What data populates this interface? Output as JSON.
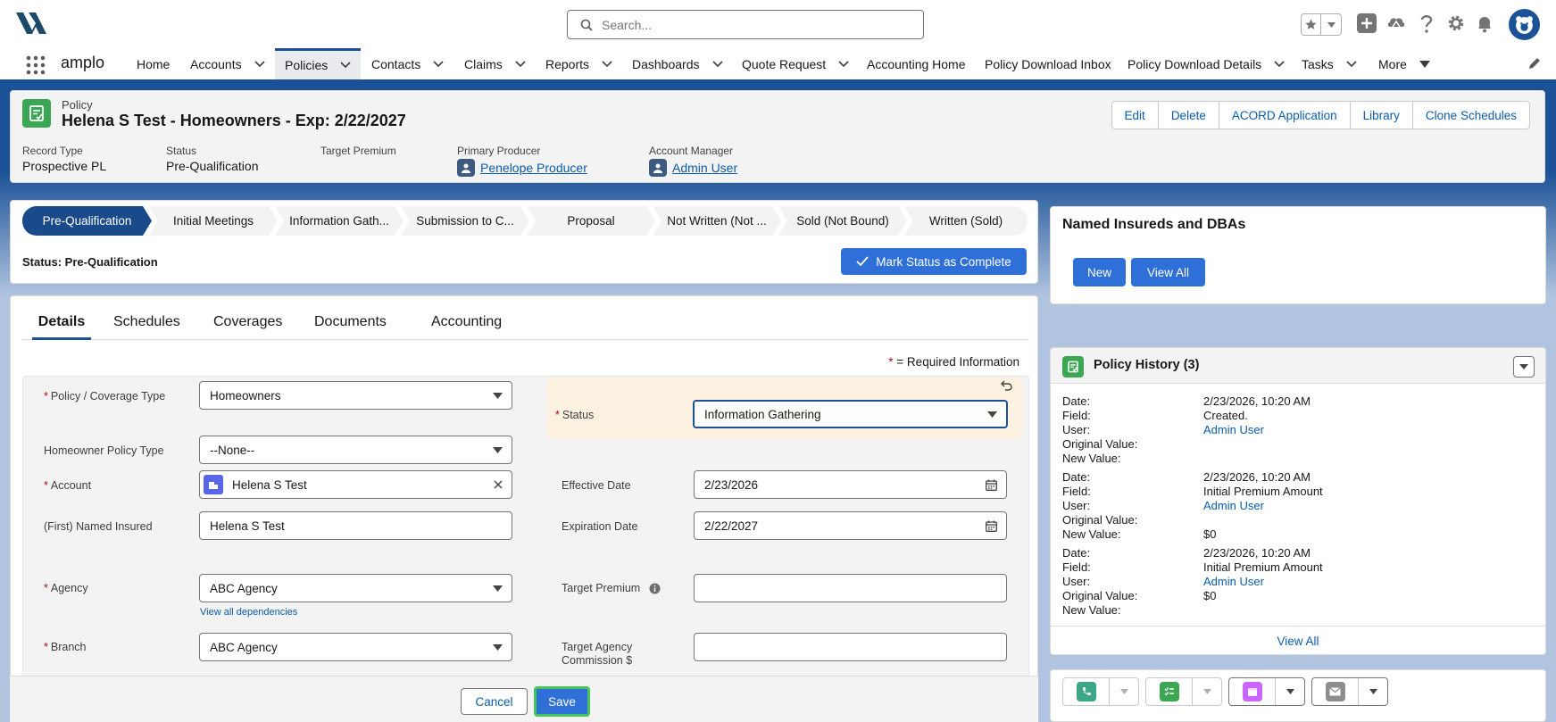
{
  "app": {
    "name": "amplo"
  },
  "search": {
    "placeholder": "Search..."
  },
  "nav": {
    "items": [
      {
        "label": "Home"
      },
      {
        "label": "Accounts"
      },
      {
        "label": "Policies"
      },
      {
        "label": "Contacts"
      },
      {
        "label": "Claims"
      },
      {
        "label": "Reports"
      },
      {
        "label": "Dashboards"
      },
      {
        "label": "Quote Request"
      },
      {
        "label": "Accounting Home"
      },
      {
        "label": "Policy Download Inbox"
      },
      {
        "label": "Policy Download Details"
      },
      {
        "label": "Tasks"
      },
      {
        "label": "More"
      }
    ],
    "active": "Policies"
  },
  "record": {
    "object_type": "Policy",
    "name": "Helena S Test - Homeowners - Exp: 2/22/2027",
    "actions": [
      "Edit",
      "Delete",
      "ACORD Application",
      "Library",
      "Clone Schedules"
    ],
    "fields": {
      "record_type_label": "Record Type",
      "record_type_value": "Prospective PL",
      "status_label": "Status",
      "status_value": "Pre-Qualification",
      "target_premium_label": "Target Premium",
      "primary_producer_label": "Primary Producer",
      "primary_producer_value": "Penelope Producer",
      "account_manager_label": "Account Manager",
      "account_manager_value": "Admin User"
    }
  },
  "path": {
    "steps": [
      "Pre-Qualification",
      "Initial Meetings",
      "Information Gath...",
      "Submission to C...",
      "Proposal",
      "Not Written (Not ...",
      "Sold (Not Bound)",
      "Written (Sold)"
    ],
    "current": "Pre-Qualification",
    "status_text": "Status: Pre-Qualification",
    "mark_complete_label": "Mark Status as Complete"
  },
  "tabs": [
    "Details",
    "Schedules",
    "Coverages",
    "Documents",
    "Accounting"
  ],
  "active_tab": "Details",
  "form": {
    "required_info": "= Required Information",
    "policy_coverage_type_label": "Policy / Coverage Type",
    "policy_coverage_type_value": "Homeowners",
    "homeowner_policy_type_label": "Homeowner Policy Type",
    "homeowner_policy_type_value": "--None--",
    "account_label": "Account",
    "account_value": "Helena S Test",
    "named_insured_label": "(First) Named Insured",
    "named_insured_value": "Helena S Test",
    "agency_label": "Agency",
    "agency_value": "ABC Agency",
    "view_dependencies": "View all dependencies",
    "branch_label": "Branch",
    "branch_value": "ABC Agency",
    "status_label": "Status",
    "status_value": "Information Gathering",
    "effective_date_label": "Effective Date",
    "effective_date_value": "2/23/2026",
    "expiration_date_label": "Expiration Date",
    "expiration_date_value": "2/22/2027",
    "target_premium_label": "Target Premium",
    "target_premium_value": "",
    "target_agency_commission_label": "Target Agency Commission $",
    "target_agency_commission_value": ""
  },
  "footer": {
    "cancel_label": "Cancel",
    "save_label": "Save"
  },
  "named_insureds": {
    "title": "Named Insureds and DBAs",
    "new_label": "New",
    "view_all_label": "View All"
  },
  "policy_history": {
    "title": "Policy History (3)",
    "field_labels": {
      "date": "Date:",
      "field": "Field:",
      "user": "User:",
      "original": "Original Value:",
      "new": "New Value:"
    },
    "entries": [
      {
        "date": "2/23/2026, 10:20 AM",
        "field": "Created.",
        "user": "Admin User",
        "original": "",
        "new": ""
      },
      {
        "date": "2/23/2026, 10:20 AM",
        "field": "Initial Premium Amount",
        "user": "Admin User",
        "original": "",
        "new": "$0"
      },
      {
        "date": "2/23/2026, 10:20 AM",
        "field": "Initial Premium Amount",
        "user": "Admin User",
        "original": "$0",
        "new": ""
      }
    ],
    "view_all_label": "View All"
  },
  "colors": {
    "brand": "#1b5297",
    "button": "#2e6fd8",
    "success": "#3ba755",
    "link": "#0b5cab",
    "edited_field": "#fdf1e1"
  }
}
